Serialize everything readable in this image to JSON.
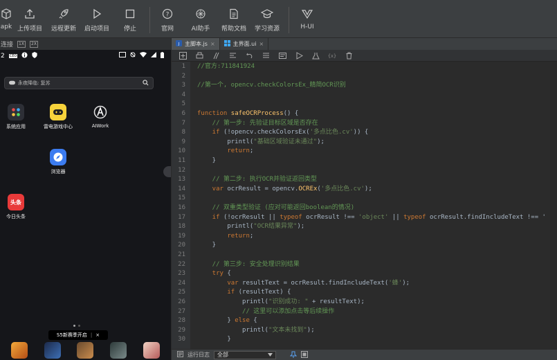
{
  "toolbar": {
    "items": [
      {
        "label": "apk",
        "icon": "package-icon"
      },
      {
        "label": "上传项目",
        "icon": "upload-icon"
      },
      {
        "label": "远程更新",
        "icon": "rocket-icon"
      },
      {
        "label": "启动项目",
        "icon": "play-icon"
      },
      {
        "label": "停止",
        "icon": "stop-icon"
      },
      {
        "label": "官网",
        "icon": "help-circle-icon"
      },
      {
        "label": "AI助手",
        "icon": "ai-icon"
      },
      {
        "label": "帮助文档",
        "icon": "document-icon"
      },
      {
        "label": "学习资源",
        "icon": "graduation-cap-icon"
      },
      {
        "label": "H-UI",
        "icon": "hui-logo-icon"
      }
    ]
  },
  "left_panel": {
    "connection_label": "连接",
    "scale_1": "1X",
    "scale_2": "2X",
    "status_time": "2",
    "status_badge": "CEO",
    "search_prefix": "永夜降临: 复苏",
    "apps": [
      {
        "label": "系统应用",
        "icon": "system-apps-icon"
      },
      {
        "label": "雷电游戏中心",
        "icon": "game-controller-icon"
      },
      {
        "label": "AIWork",
        "icon": "aiwork-icon"
      },
      {
        "label": "浏览器",
        "icon": "browser-icon"
      },
      {
        "label": "今日头条",
        "icon": "toutiao-icon",
        "badge": "头条"
      }
    ],
    "banner_text": "S5新赛季开启",
    "banner_close": "×"
  },
  "editor": {
    "tabs": [
      {
        "label": "主脚本.js",
        "active": true
      },
      {
        "label": "主界面.ui",
        "active": false
      }
    ],
    "tab_close": "×",
    "code_lines": [
      {
        "n": "1",
        "parts": [
          {
            "c": "c-cm",
            "t": "//官方:711841924"
          }
        ]
      },
      {
        "n": "2",
        "parts": []
      },
      {
        "n": "3",
        "parts": [
          {
            "c": "c-cm",
            "t": "//第一个, opencv.checkColorsEx_精简OCR识别"
          }
        ]
      },
      {
        "n": "4",
        "parts": []
      },
      {
        "n": "5",
        "parts": []
      },
      {
        "n": "6",
        "parts": [
          {
            "c": "c-kw",
            "t": "function "
          },
          {
            "c": "c-fn",
            "t": "safeOCRProcess"
          },
          {
            "c": "c-tx",
            "t": "() {"
          }
        ]
      },
      {
        "n": "7",
        "parts": [
          {
            "c": "c-cm",
            "t": "    // 第一步: 先验证目标区域是否存在"
          }
        ]
      },
      {
        "n": "8",
        "parts": [
          {
            "c": "c-kw",
            "t": "    if "
          },
          {
            "c": "c-tx",
            "t": "(!opencv.checkColorsEx("
          },
          {
            "c": "c-st",
            "t": "'多点比色.cv'"
          },
          {
            "c": "c-tx",
            "t": ")) {"
          }
        ]
      },
      {
        "n": "9",
        "parts": [
          {
            "c": "c-tx",
            "t": "        printl("
          },
          {
            "c": "c-st",
            "t": "\"基础区域验证未通过\""
          },
          {
            "c": "c-tx",
            "t": ");"
          }
        ]
      },
      {
        "n": "10",
        "parts": [
          {
            "c": "c-kw",
            "t": "        return"
          },
          {
            "c": "c-tx",
            "t": ";"
          }
        ]
      },
      {
        "n": "11",
        "parts": [
          {
            "c": "c-tx",
            "t": "    }"
          }
        ]
      },
      {
        "n": "12",
        "parts": []
      },
      {
        "n": "13",
        "parts": [
          {
            "c": "c-cm",
            "t": "    // 第二步: 执行OCR并验证返回类型"
          }
        ]
      },
      {
        "n": "14",
        "parts": [
          {
            "c": "c-kw",
            "t": "    var "
          },
          {
            "c": "c-tx",
            "t": "ocrResult = opencv."
          },
          {
            "c": "c-fn",
            "t": "OCREx"
          },
          {
            "c": "c-tx",
            "t": "("
          },
          {
            "c": "c-st",
            "t": "'多点比色.cv'"
          },
          {
            "c": "c-tx",
            "t": ");"
          }
        ]
      },
      {
        "n": "15",
        "parts": []
      },
      {
        "n": "16",
        "parts": [
          {
            "c": "c-cm",
            "t": "    // 双重类型验证 (应对可能返回boolean的情况)"
          }
        ]
      },
      {
        "n": "17",
        "parts": [
          {
            "c": "c-kw",
            "t": "    if "
          },
          {
            "c": "c-tx",
            "t": "(!ocrResult || "
          },
          {
            "c": "c-kw",
            "t": "typeof "
          },
          {
            "c": "c-tx",
            "t": "ocrResult !== "
          },
          {
            "c": "c-st",
            "t": "'object'"
          },
          {
            "c": "c-tx",
            "t": " || "
          },
          {
            "c": "c-kw",
            "t": "typeof "
          },
          {
            "c": "c-tx",
            "t": "ocrResult.findIncludeText !== '"
          }
        ]
      },
      {
        "n": "18",
        "parts": [
          {
            "c": "c-tx",
            "t": "        printl("
          },
          {
            "c": "c-st",
            "t": "\"OCR结果异常\""
          },
          {
            "c": "c-tx",
            "t": ");"
          }
        ]
      },
      {
        "n": "19",
        "parts": [
          {
            "c": "c-kw",
            "t": "        return"
          },
          {
            "c": "c-tx",
            "t": ";"
          }
        ]
      },
      {
        "n": "20",
        "parts": [
          {
            "c": "c-tx",
            "t": "    }"
          }
        ]
      },
      {
        "n": "21",
        "parts": []
      },
      {
        "n": "22",
        "parts": [
          {
            "c": "c-cm",
            "t": "    // 第三步: 安全处理识别结果"
          }
        ]
      },
      {
        "n": "23",
        "parts": [
          {
            "c": "c-kw",
            "t": "    try "
          },
          {
            "c": "c-tx",
            "t": "{"
          }
        ]
      },
      {
        "n": "24",
        "parts": [
          {
            "c": "c-kw",
            "t": "        var "
          },
          {
            "c": "c-tx",
            "t": "resultText = ocrResult.findIncludeText("
          },
          {
            "c": "c-st",
            "t": "'蜂'"
          },
          {
            "c": "c-tx",
            "t": ");"
          }
        ]
      },
      {
        "n": "25",
        "parts": [
          {
            "c": "c-kw",
            "t": "        if "
          },
          {
            "c": "c-tx",
            "t": "(resultText) {"
          }
        ]
      },
      {
        "n": "26",
        "parts": [
          {
            "c": "c-tx",
            "t": "            printl("
          },
          {
            "c": "c-st",
            "t": "\"识别成功: \""
          },
          {
            "c": "c-tx",
            "t": " + resultText);"
          }
        ]
      },
      {
        "n": "27",
        "parts": [
          {
            "c": "c-cm",
            "t": "            // 这里可以添加点击等后续操作"
          }
        ]
      },
      {
        "n": "28",
        "parts": [
          {
            "c": "c-tx",
            "t": "        } "
          },
          {
            "c": "c-kw",
            "t": "else "
          },
          {
            "c": "c-tx",
            "t": "{"
          }
        ]
      },
      {
        "n": "29",
        "parts": [
          {
            "c": "c-tx",
            "t": "            printl("
          },
          {
            "c": "c-st",
            "t": "\"文本未找到\""
          },
          {
            "c": "c-tx",
            "t": ");"
          }
        ]
      },
      {
        "n": "30",
        "parts": [
          {
            "c": "c-tx",
            "t": "        }"
          }
        ]
      }
    ],
    "bottom": {
      "log_label": "运行日志",
      "filter_value": "全部"
    }
  }
}
